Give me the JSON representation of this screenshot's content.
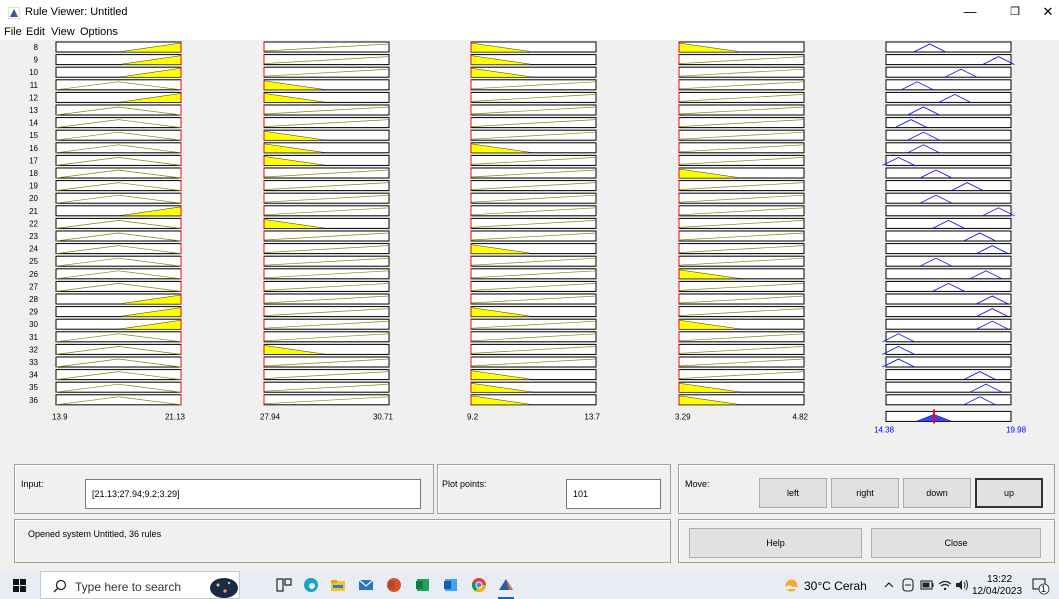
{
  "window": {
    "title": "Rule Viewer: Untitled",
    "min_glyph": "—",
    "max_glyph": "❒",
    "close_glyph": "✕"
  },
  "menu": [
    "File",
    "Edit",
    "View",
    "Options"
  ],
  "rules": {
    "visible_numbers": [
      "8",
      "9",
      "10",
      "11",
      "12",
      "13",
      "14",
      "15",
      "16",
      "17",
      "18",
      "19",
      "20",
      "21",
      "22",
      "23",
      "24",
      "25",
      "26",
      "27",
      "28",
      "29",
      "30",
      "31",
      "32",
      "33",
      "34",
      "35",
      "36"
    ],
    "input_columns": [
      {
        "min_label": "13.9",
        "max_label": "21.13"
      },
      {
        "min_label": "27.94",
        "max_label": "30.71"
      },
      {
        "min_label": "9.2",
        "max_label": "13.7"
      },
      {
        "min_label": "3.29",
        "max_label": "4.82"
      }
    ],
    "output_column": {
      "min_label": "14.38",
      "max_label": "19.98"
    },
    "colors": {
      "fill": "#ffff00",
      "output_line": "#0000ff",
      "indicator": "#ff0000"
    }
  },
  "controls": {
    "input_label": "Input:",
    "input_value": "[21.13;27.94;9.2;3.29]",
    "plot_points_label": "Plot points:",
    "plot_points_value": "101",
    "move_label": "Move:",
    "left_label": "left",
    "right_label": "right",
    "down_label": "down",
    "up_label": "up",
    "status": "Opened system Untitled, 36 rules",
    "help_label": "Help",
    "close_label": "Close"
  },
  "taskbar": {
    "search_placeholder": "Type here to search",
    "weather": "30°C Cerah",
    "time": "13:22",
    "date": "12/04/2023",
    "notification_count": "1"
  }
}
